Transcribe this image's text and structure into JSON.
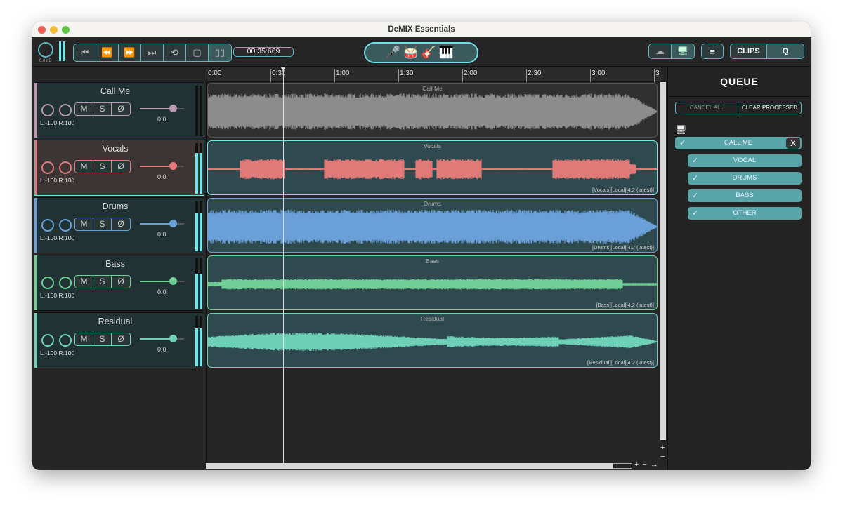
{
  "window": {
    "title": "DeMIX Essentials"
  },
  "toolbar": {
    "master_gain": "0.0 dB",
    "timecode": "00:35:669",
    "transport": [
      {
        "name": "skip-start",
        "glyph": "⏮"
      },
      {
        "name": "rewind",
        "glyph": "⏪"
      },
      {
        "name": "fast-forward",
        "glyph": "⏩"
      },
      {
        "name": "skip-end",
        "glyph": "⏭"
      },
      {
        "name": "loop",
        "glyph": "⟲"
      },
      {
        "name": "stop",
        "glyph": "▢"
      },
      {
        "name": "pause",
        "glyph": "▯▯"
      }
    ],
    "instruments": "🎤🥁🎸🎹",
    "view_icons": [
      "cloud-icon",
      "monitor-icon"
    ],
    "menu_icon": "menu-icon",
    "clips_label": "CLIPS",
    "q_label": "Q"
  },
  "ruler": {
    "ticks": [
      "0:00",
      "0:30",
      "1:00",
      "1:30",
      "2:00",
      "2:30",
      "3:00",
      "3"
    ]
  },
  "playhead_seconds": 35.669,
  "tracks": [
    {
      "name": "Call Me",
      "pan": "L:-100 R:100",
      "volume": "0.0",
      "color": "#b99ab0",
      "wave": "#8c8c8c",
      "clip_label": "Call Me",
      "info": "",
      "meter": 0,
      "bg": "#203234"
    },
    {
      "name": "Vocals",
      "pan": "L:-100 R:100",
      "volume": "0.0",
      "color": "#e07a78",
      "wave": "#e07a78",
      "clip_label": "Vocals",
      "info": "[Vocals][Local][4.2 (latest)]",
      "meter": 0.8,
      "bg": "#3d3434"
    },
    {
      "name": "Drums",
      "pan": "L:-100 R:100",
      "volume": "0.0",
      "color": "#6a9fd8",
      "wave": "#6a9fd8",
      "clip_label": "Drums",
      "info": "[Drums][Local][4.2 (latest)]",
      "meter": 0.75,
      "bg": "#203234"
    },
    {
      "name": "Bass",
      "pan": "L:-100 R:100",
      "volume": "0.0",
      "color": "#6fcf97",
      "wave": "#6fcf97",
      "clip_label": "Bass",
      "info": "[Bass][Local][4.2 (latest)]",
      "meter": 0.7,
      "bg": "#203234"
    },
    {
      "name": "Residual",
      "pan": "L:-100 R:100",
      "volume": "0.0",
      "color": "#6fd0b8",
      "wave": "#6fd0b8",
      "clip_label": "Residual",
      "info": "[Residual][Local][4.2 (latest)]",
      "meter": 0.75,
      "bg": "#203234"
    }
  ],
  "buttons": {
    "mute": "M",
    "solo": "S",
    "phase": "Ø"
  },
  "queue": {
    "title": "QUEUE",
    "cancel_all": "CANCEL ALL",
    "clear_processed": "CLEAR PROCESSED",
    "job": {
      "name": "CALL ME",
      "close": "X",
      "status": "done"
    },
    "stems": [
      {
        "name": "VOCAL",
        "status": "done"
      },
      {
        "name": "DRUMS",
        "status": "done"
      },
      {
        "name": "BASS",
        "status": "done"
      },
      {
        "name": "OTHER",
        "status": "done"
      }
    ]
  },
  "zoom": {
    "plus": "+",
    "minus": "−",
    "fit": "↔"
  }
}
